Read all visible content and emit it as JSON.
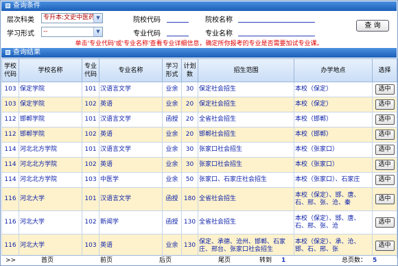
{
  "conditions": {
    "title": "查询条件",
    "level_label": "层次科类",
    "level_value": "专升本:文史中医药",
    "mode_label": "学习形式",
    "mode_value": "--",
    "school_code_label": "院校代码",
    "school_name_label": "院校名称",
    "major_code_label": "专业代码",
    "major_name_label": "专业名称",
    "query_button": "查 询",
    "notice": "单击'专业代码'或'专业名称'查看专业详细信息，确定所你报考的专业是否需要加试专业课。"
  },
  "results": {
    "title": "查询结果",
    "headers": [
      "学校\n代码",
      "学校名称",
      "专业\n代码",
      "专业名称",
      "学习\n形式",
      "计划\n数",
      "招生范围",
      "办学地点",
      "选择"
    ],
    "select_label": "选中",
    "rows": [
      {
        "school_code": "103",
        "school": "保定学院",
        "major_code": "101",
        "major": "汉语言文学",
        "mode": "业余",
        "plan": "30",
        "scope": "保定社会招生",
        "location": "本校（保定）"
      },
      {
        "school_code": "103",
        "school": "保定学院",
        "major_code": "102",
        "major": "英语",
        "mode": "业余",
        "plan": "20",
        "scope": "保定社会招生",
        "location": "本校（保定）"
      },
      {
        "school_code": "112",
        "school": "邯郸学院",
        "major_code": "101",
        "major": "汉语言文学",
        "mode": "函授",
        "plan": "20",
        "scope": "全省社会招生",
        "location": "本校（邯郸）"
      },
      {
        "school_code": "112",
        "school": "邯郸学院",
        "major_code": "102",
        "major": "英语",
        "mode": "业余",
        "plan": "20",
        "scope": "邯郸社会招生",
        "location": "本校（邯郸）"
      },
      {
        "school_code": "114",
        "school": "河北北方学院",
        "major_code": "101",
        "major": "汉语言文学",
        "mode": "业余",
        "plan": "30",
        "scope": "张家口社会招生",
        "location": "本校（张家口）"
      },
      {
        "school_code": "114",
        "school": "河北北方学院",
        "major_code": "102",
        "major": "英语",
        "mode": "业余",
        "plan": "30",
        "scope": "张家口社会招生",
        "location": "本校（张家口）"
      },
      {
        "school_code": "114",
        "school": "河北北方学院",
        "major_code": "103",
        "major": "中医学",
        "mode": "业余",
        "plan": "50",
        "scope": "张家口、石家庄社会招生",
        "location": "本校（张家口）、石家庄"
      },
      {
        "school_code": "116",
        "school": "河北大学",
        "major_code": "101",
        "major": "汉语言文学",
        "mode": "函授",
        "plan": "180",
        "scope": "全省社会招生",
        "location": "本校（保定）、邯、唐、石、邢、张、沧、秦"
      },
      {
        "school_code": "116",
        "school": "河北大学",
        "major_code": "102",
        "major": "新闻学",
        "mode": "函授",
        "plan": "130",
        "scope": "全省社会招生",
        "location": "本校（保定）、邯、唐、石、邢、张、沧"
      },
      {
        "school_code": "116",
        "school": "河北大学",
        "major_code": "103",
        "major": "英语",
        "mode": "业余",
        "plan": "130",
        "scope": "保定、承德、沧州、邯郸、石家庄、邢台、张家口社会招生",
        "location": "本校（保定）、承、沧、邯、石、邢、张"
      }
    ]
  },
  "pager": {
    "marker": ">>",
    "first": "首页",
    "prev": "前页",
    "next": "后页",
    "last": "尾页",
    "goto_label": "转到",
    "goto_value": "1",
    "total_label": "总页数：",
    "total_value": "5"
  }
}
